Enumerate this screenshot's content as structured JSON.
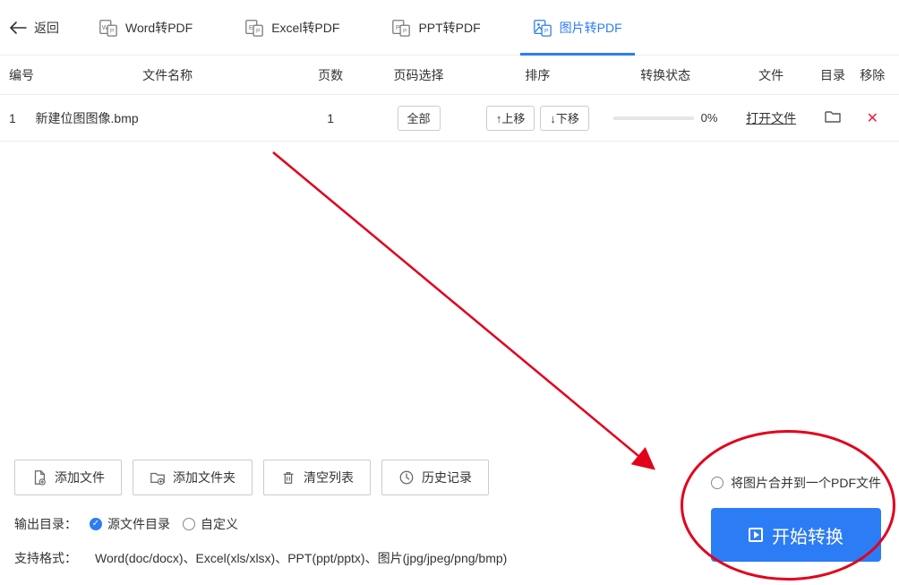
{
  "topbar": {
    "back": "返回",
    "tabs": [
      {
        "label": "Word转PDF"
      },
      {
        "label": "Excel转PDF"
      },
      {
        "label": "PPT转PDF"
      },
      {
        "label": "图片转PDF",
        "active": true
      }
    ]
  },
  "columns": {
    "idx": "编号",
    "name": "文件名称",
    "pages": "页数",
    "range": "页码选择",
    "order": "排序",
    "status": "转换状态",
    "file": "文件",
    "dir": "目录",
    "remove": "移除"
  },
  "rows": [
    {
      "idx": "1",
      "name": "新建位图图像.bmp",
      "pages": "1",
      "range_btn": "全部",
      "move_up": "↑上移",
      "move_down": "↓下移",
      "progress_pct": "0%",
      "open_label": "打开文件"
    }
  ],
  "actions": {
    "add_file": "添加文件",
    "add_folder": "添加文件夹",
    "clear_list": "清空列表",
    "history": "历史记录"
  },
  "outdir": {
    "label": "输出目录：",
    "source": "源文件目录",
    "custom": "自定义"
  },
  "formats": {
    "label": "支持格式：",
    "value": "Word(doc/docx)、Excel(xls/xlsx)、PPT(ppt/pptx)、图片(jpg/jpeg/png/bmp)"
  },
  "merge_label": "将图片合并到一个PDF文件",
  "start_label": "开始转换"
}
